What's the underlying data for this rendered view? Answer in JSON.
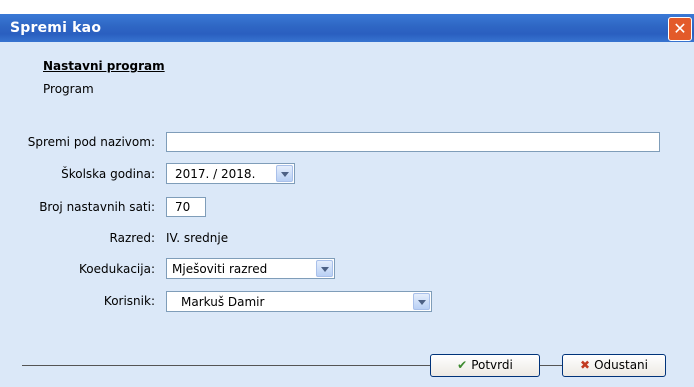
{
  "window": {
    "title": "Spremi kao"
  },
  "section": {
    "heading": "Nastavni program",
    "subtitle": "Program"
  },
  "form": {
    "name_label": "Spremi pod nazivom:",
    "name_value": "",
    "year_label": "Školska godina:",
    "year_value": "2017. / 2018.",
    "hours_label": "Broj nastavnih sati:",
    "hours_value": "70",
    "grade_label": "Razred:",
    "grade_value": "IV. srednje",
    "coed_label": "Koedukacija:",
    "coed_value": "Mješoviti razred",
    "user_label": "Korisnik:",
    "user_value": "Markuš Damir"
  },
  "buttons": {
    "confirm_label": "Potvrdi",
    "cancel_label": "Odustani"
  },
  "icons": {
    "close": "close-icon",
    "confirm": "check-icon",
    "cancel": "x-icon"
  }
}
